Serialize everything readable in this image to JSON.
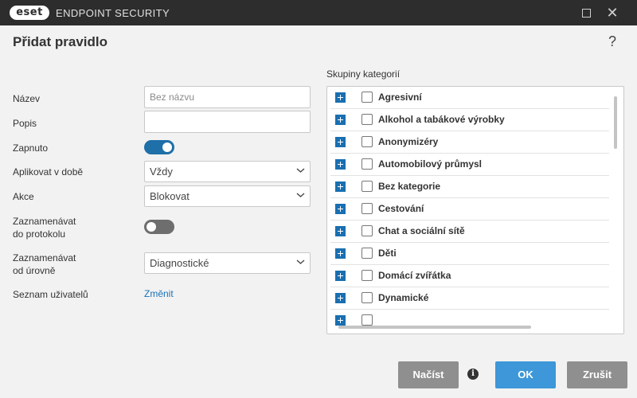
{
  "window": {
    "logo_text": "eset",
    "app_title": "ENDPOINT SECURITY"
  },
  "dialog": {
    "title": "Přidat pravidlo",
    "help_label": "?"
  },
  "form": {
    "name_label": "Název",
    "name_placeholder": "Bez názvu",
    "description_label": "Popis",
    "description_value": "",
    "enabled_label": "Zapnuto",
    "enabled": true,
    "apply_time_label": "Aplikovat v době",
    "apply_time_value": "Vždy",
    "action_label": "Akce",
    "action_value": "Blokovat",
    "log_label_line1": "Zaznamenávat",
    "log_label_line2": "do protokolu",
    "log_enabled": false,
    "log_level_label_line1": "Zaznamenávat",
    "log_level_label_line2": "od úrovně",
    "log_level_value": "Diagnostické",
    "user_list_label": "Seznam uživatelů",
    "user_list_link": "Změnit"
  },
  "categories": {
    "title": "Skupiny kategorií",
    "items": [
      {
        "label": "Agresivní",
        "checked": false
      },
      {
        "label": "Alkohol a tabákové výrobky",
        "checked": false
      },
      {
        "label": "Anonymizéry",
        "checked": false
      },
      {
        "label": "Automobilový průmysl",
        "checked": false
      },
      {
        "label": "Bez kategorie",
        "checked": false
      },
      {
        "label": "Cestování",
        "checked": false
      },
      {
        "label": "Chat a sociální sítě",
        "checked": false
      },
      {
        "label": "Děti",
        "checked": false
      },
      {
        "label": "Domácí zvířátka",
        "checked": false
      },
      {
        "label": "Dynamické",
        "checked": false
      }
    ]
  },
  "footer": {
    "load_label": "Načíst",
    "info_label": "i",
    "ok_label": "OK",
    "cancel_label": "Zrušit"
  },
  "colors": {
    "titlebar": "#2d2d2d",
    "accent": "#1f6fa8",
    "ok_button": "#3d97d8",
    "secondary_button": "#8f8f8f",
    "link": "#1a73b8"
  }
}
